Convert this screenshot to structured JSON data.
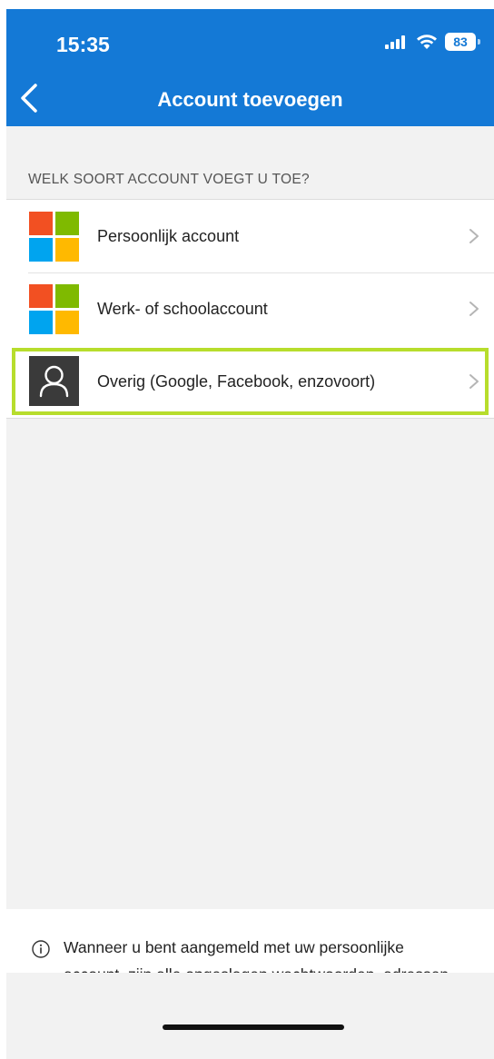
{
  "header": {
    "time": "15:35",
    "battery": "83",
    "title": "Account toevoegen"
  },
  "section_label": "WELK SOORT ACCOUNT VOEGT U TOE?",
  "accounts": [
    {
      "label": "Persoonlijk account",
      "icon": "microsoft-logo-icon"
    },
    {
      "label": "Werk- of schoolaccount",
      "icon": "microsoft-logo-icon"
    },
    {
      "label": "Overig (Google, Facebook, enzovoort)",
      "icon": "person-icon",
      "highlighted": true
    }
  ],
  "footer": {
    "info_text": "Wanneer u bent aangemeld met uw persoonlijke account, zijn alle opgeslagen wachtwoorden, adressen en andere gegevens voor automatisch invullen beschikbaar op dit apparaat."
  },
  "colors": {
    "header_blue": "#1479d6",
    "highlight_green": "#b7dd2c",
    "ms_red": "#f25022",
    "ms_green": "#7fba00",
    "ms_blue": "#00a4ef",
    "ms_yellow": "#ffb900"
  }
}
